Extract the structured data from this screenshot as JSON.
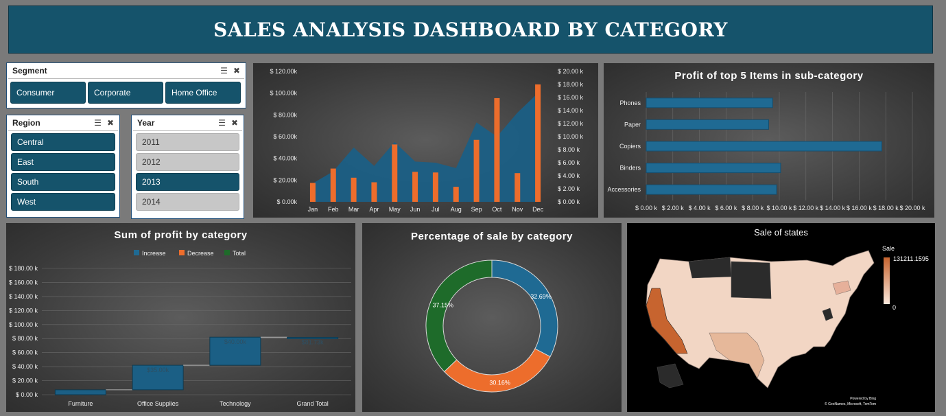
{
  "title": "SALES ANALYSIS DASHBOARD BY CATEGORY",
  "slicers": {
    "segment": {
      "label": "Segment",
      "items": [
        {
          "label": "Consumer",
          "selected": true
        },
        {
          "label": "Corporate",
          "selected": true
        },
        {
          "label": "Home Office",
          "selected": true
        }
      ]
    },
    "region": {
      "label": "Region",
      "items": [
        {
          "label": "Central",
          "selected": true
        },
        {
          "label": "East",
          "selected": true
        },
        {
          "label": "South",
          "selected": true
        },
        {
          "label": "West",
          "selected": true
        }
      ]
    },
    "year": {
      "label": "Year",
      "items": [
        {
          "label": "2011",
          "selected": false
        },
        {
          "label": "2012",
          "selected": false
        },
        {
          "label": "2013",
          "selected": true
        },
        {
          "label": "2014",
          "selected": false
        }
      ]
    }
  },
  "colors": {
    "accent": "#15536b",
    "orange": "#ed6d2c",
    "green": "#1e6b2a",
    "blue": "#1f6a93"
  },
  "chart_data": [
    {
      "id": "monthly",
      "type": "area+bar",
      "categories": [
        "Jan",
        "Feb",
        "Mar",
        "Apr",
        "May",
        "Jun",
        "Jul",
        "Aug",
        "Sep",
        "Oct",
        "Nov",
        "Dec"
      ],
      "series": [
        {
          "kind": "area",
          "axis": "left",
          "values": [
            17000,
            28000,
            50000,
            33000,
            55000,
            37000,
            36000,
            31000,
            73000,
            60000,
            82000,
            100000
          ]
        },
        {
          "kind": "bar",
          "axis": "right",
          "values": [
            2900,
            5100,
            3700,
            3000,
            8800,
            4600,
            4500,
            2300,
            9500,
            15900,
            4400,
            18000
          ]
        }
      ],
      "left_ticks": [
        "$ 0.00k",
        "$ 20.00k",
        "$ 40.00k",
        "$ 60.00k",
        "$ 80.00k",
        "$ 100.00k",
        "$ 120.00k"
      ],
      "right_ticks": [
        "$ 0.00 k",
        "$ 2.00 k",
        "$ 4.00 k",
        "$ 6.00 k",
        "$ 8.00 k",
        "$ 10.00 k",
        "$ 12.00 k",
        "$ 14.00 k",
        "$ 16.00 k",
        "$ 18.00 k",
        "$ 20.00 k"
      ],
      "ylim_left": [
        0,
        120000
      ],
      "ylim_right": [
        0,
        20000
      ]
    },
    {
      "id": "top5",
      "type": "bar",
      "orientation": "horizontal",
      "title": "Profit of top 5 Items in sub-category",
      "categories": [
        "Phones",
        "Paper",
        "Copiers",
        "Binders",
        "Accessories"
      ],
      "values": [
        9500,
        9200,
        17700,
        10100,
        9800
      ],
      "x_ticks": [
        "$ 0.00 k",
        "$ 2.00 k",
        "$ 4.00 k",
        "$ 6.00 k",
        "$ 8.00 k",
        "$ 10.00 k",
        "$ 12.00 k",
        "$ 14.00 k",
        "$ 16.00 k",
        "$ 18.00 k",
        "$ 20.00 k"
      ],
      "xlim": [
        0,
        20000
      ]
    },
    {
      "id": "waterfall",
      "type": "waterfall",
      "title": "Sum of profit by category",
      "legend": [
        "Increase",
        "Decrease",
        "Total"
      ],
      "categories": [
        "Furniture",
        "Office Supplies",
        "Technology",
        "Grand Total"
      ],
      "values": [
        7000,
        35000,
        40000,
        81730
      ],
      "data_labels": [
        "",
        "$35.00k",
        "$40.00k",
        "$81.73k"
      ],
      "y_ticks": [
        "$ 0.00 k",
        "$ 20.00 k",
        "$ 40.00 k",
        "$ 60.00 k",
        "$ 80.00 k",
        "$ 100.00 k",
        "$ 120.00 k",
        "$ 140.00 k",
        "$ 160.00 k",
        "$ 180.00 k"
      ],
      "ylim": [
        0,
        180000
      ]
    },
    {
      "id": "donut",
      "type": "pie",
      "title": "Percentage of sale by category",
      "slices": [
        {
          "value": 32.69,
          "label": "32.69%",
          "color": "#1f6a93"
        },
        {
          "value": 30.16,
          "label": "30.16%",
          "color": "#ed6d2c"
        },
        {
          "value": 37.15,
          "label": "37.15%",
          "color": "#1e6b2a"
        }
      ]
    },
    {
      "id": "map",
      "type": "map",
      "title": "Sale of states",
      "legend_title": "Sale",
      "legend_max": "131211.1595",
      "legend_min": "0",
      "credit1": "Powered by Bing",
      "credit2": "© GeoNames, Microsoft, TomTom"
    }
  ]
}
